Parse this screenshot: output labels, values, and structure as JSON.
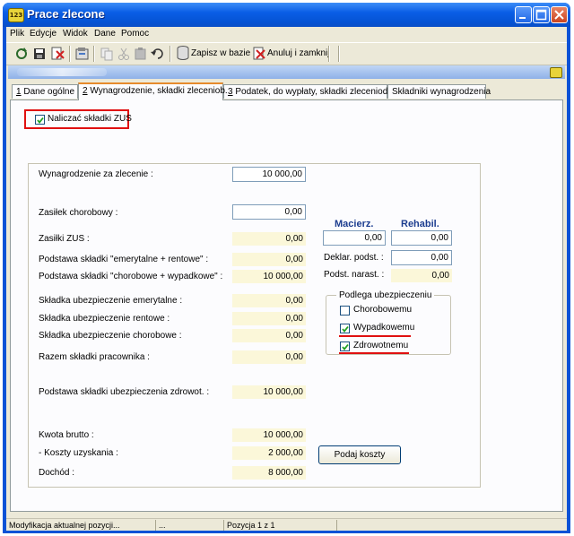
{
  "window": {
    "title": "Prace zlecone",
    "app_icon_text": "123"
  },
  "menu": [
    "Plik",
    "Edycje",
    "Widok",
    "Dane",
    "Pomoc"
  ],
  "toolbar": {
    "save_label": "Zapisz w bazie",
    "cancel_label": "Anuluj i zamknij"
  },
  "tabs": [
    {
      "key": "1",
      "label": "Dane ogólne"
    },
    {
      "key": "2",
      "label": "Wynagrodzenie, składki zleceniob."
    },
    {
      "key": "3",
      "label": "Podatek, do wypłaty, składki zleceniod."
    },
    {
      "key": "",
      "label": "Składniki wynagrodzenia"
    }
  ],
  "form": {
    "naliczac_label": "Naliczać składki ZUS",
    "naliczac_checked": true,
    "rows": {
      "wynagrodzenie": {
        "label": "Wynagrodzenie za zlecenie :",
        "value": "10 000,00"
      },
      "zasilek_chorobowy": {
        "label": "Zasiłek chorobowy :",
        "value": "0,00"
      },
      "zasilki_zus": {
        "label": "Zasiłki ZUS :",
        "value": "0,00"
      },
      "podstawa_emer": {
        "label": "Podstawa składki  \"emerytalne + rentowe\" :",
        "value": "0,00"
      },
      "podstawa_chor": {
        "label": "Podstawa składki  \"chorobowe + wypadkowe\" :",
        "value": "10 000,00"
      },
      "skladka_emer": {
        "label": "Składka ubezpieczenie emerytalne :",
        "value": "0,00"
      },
      "skladka_rent": {
        "label": "Składka ubezpieczenie rentowe :",
        "value": "0,00"
      },
      "skladka_chor": {
        "label": "Składka ubezpieczenie chorobowe :",
        "value": "0,00"
      },
      "razem": {
        "label": "Razem składki pracownika :",
        "value": "0,00"
      },
      "podstawa_zdrow": {
        "label": "Podstawa składki ubezpieczenia zdrowot.  :",
        "value": "10 000,00"
      },
      "kwota_brutto": {
        "label": "Kwota brutto :",
        "value": "10 000,00"
      },
      "koszty": {
        "label": "- Koszty uzyskania :",
        "value": "2 000,00"
      },
      "dochod": {
        "label": "Dochód :",
        "value": "8 000,00"
      }
    },
    "right": {
      "col_macierz": "Macierz.",
      "col_rehabil": "Rehabil.",
      "macierz_value": "0,00",
      "rehabil_value": "0,00",
      "deklar_label": "Deklar. podst. :",
      "deklar_value": "0,00",
      "podst_narast_label": "Podst. narast. :",
      "podst_narast_value": "0,00",
      "podlega_title": "Podlega ubezpieczeniu",
      "chorobowemu_label": "Chorobowemu",
      "chorobowemu_checked": false,
      "wypadkowemu_label": "Wypadkowemu",
      "wypadkowemu_checked": true,
      "zdrowotnemu_label": "Zdrowotnemu",
      "zdrowotnemu_checked": true,
      "podaj_koszty": "Podaj koszty"
    }
  },
  "statusbar": {
    "message": "Modyfikacja aktualnej pozycji...",
    "dots": "...",
    "position": "Pozycja 1 z 1"
  },
  "colors": {
    "accent_red": "#e01010",
    "title_blue": "#0a5ee6",
    "readonly_field": "#fbf7d9"
  }
}
